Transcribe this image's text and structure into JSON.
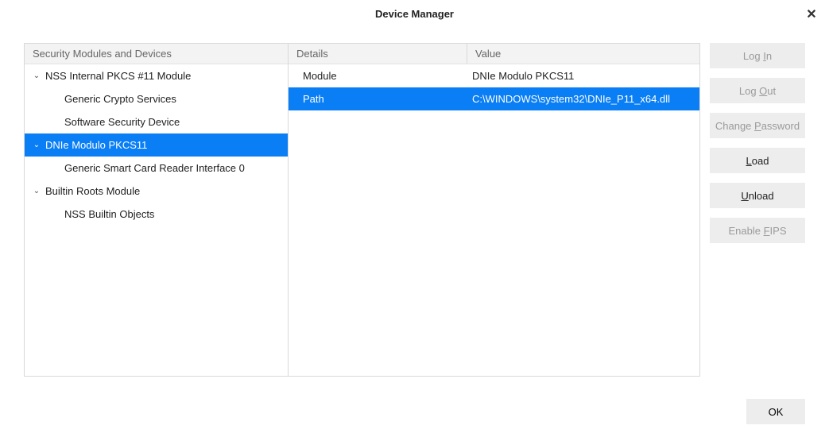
{
  "title": "Device Manager",
  "treeHeader": "Security Modules and Devices",
  "detailsHeader": "Details",
  "valueHeader": "Value",
  "tree": [
    {
      "label": "NSS Internal PKCS #11 Module",
      "indent": 0,
      "twisty": true,
      "selected": false
    },
    {
      "label": "Generic Crypto Services",
      "indent": 1,
      "twisty": false,
      "selected": false
    },
    {
      "label": "Software Security Device",
      "indent": 1,
      "twisty": false,
      "selected": false
    },
    {
      "label": "DNIe Modulo PKCS11",
      "indent": 0,
      "twisty": true,
      "selected": true
    },
    {
      "label": "Generic Smart Card Reader Interface 0",
      "indent": 1,
      "twisty": false,
      "selected": false
    },
    {
      "label": "Builtin Roots Module",
      "indent": 0,
      "twisty": true,
      "selected": false
    },
    {
      "label": "NSS Builtin Objects",
      "indent": 1,
      "twisty": false,
      "selected": false
    }
  ],
  "details": [
    {
      "key": "Module",
      "value": "DNIe Modulo PKCS11",
      "selected": false
    },
    {
      "key": "Path",
      "value": "C:\\WINDOWS\\system32\\DNIe_P11_x64.dll",
      "selected": true
    }
  ],
  "buttons": {
    "login": {
      "pre": "Log ",
      "accel": "I",
      "post": "n",
      "enabled": false
    },
    "logout": {
      "pre": "Log ",
      "accel": "O",
      "post": "ut",
      "enabled": false
    },
    "changepw": {
      "pre": "Change ",
      "accel": "P",
      "post": "assword",
      "enabled": false
    },
    "load": {
      "pre": "",
      "accel": "L",
      "post": "oad",
      "enabled": true
    },
    "unload": {
      "pre": "",
      "accel": "U",
      "post": "nload",
      "enabled": true
    },
    "fips": {
      "pre": "Enable ",
      "accel": "F",
      "post": "IPS",
      "enabled": false
    },
    "ok": "OK"
  }
}
